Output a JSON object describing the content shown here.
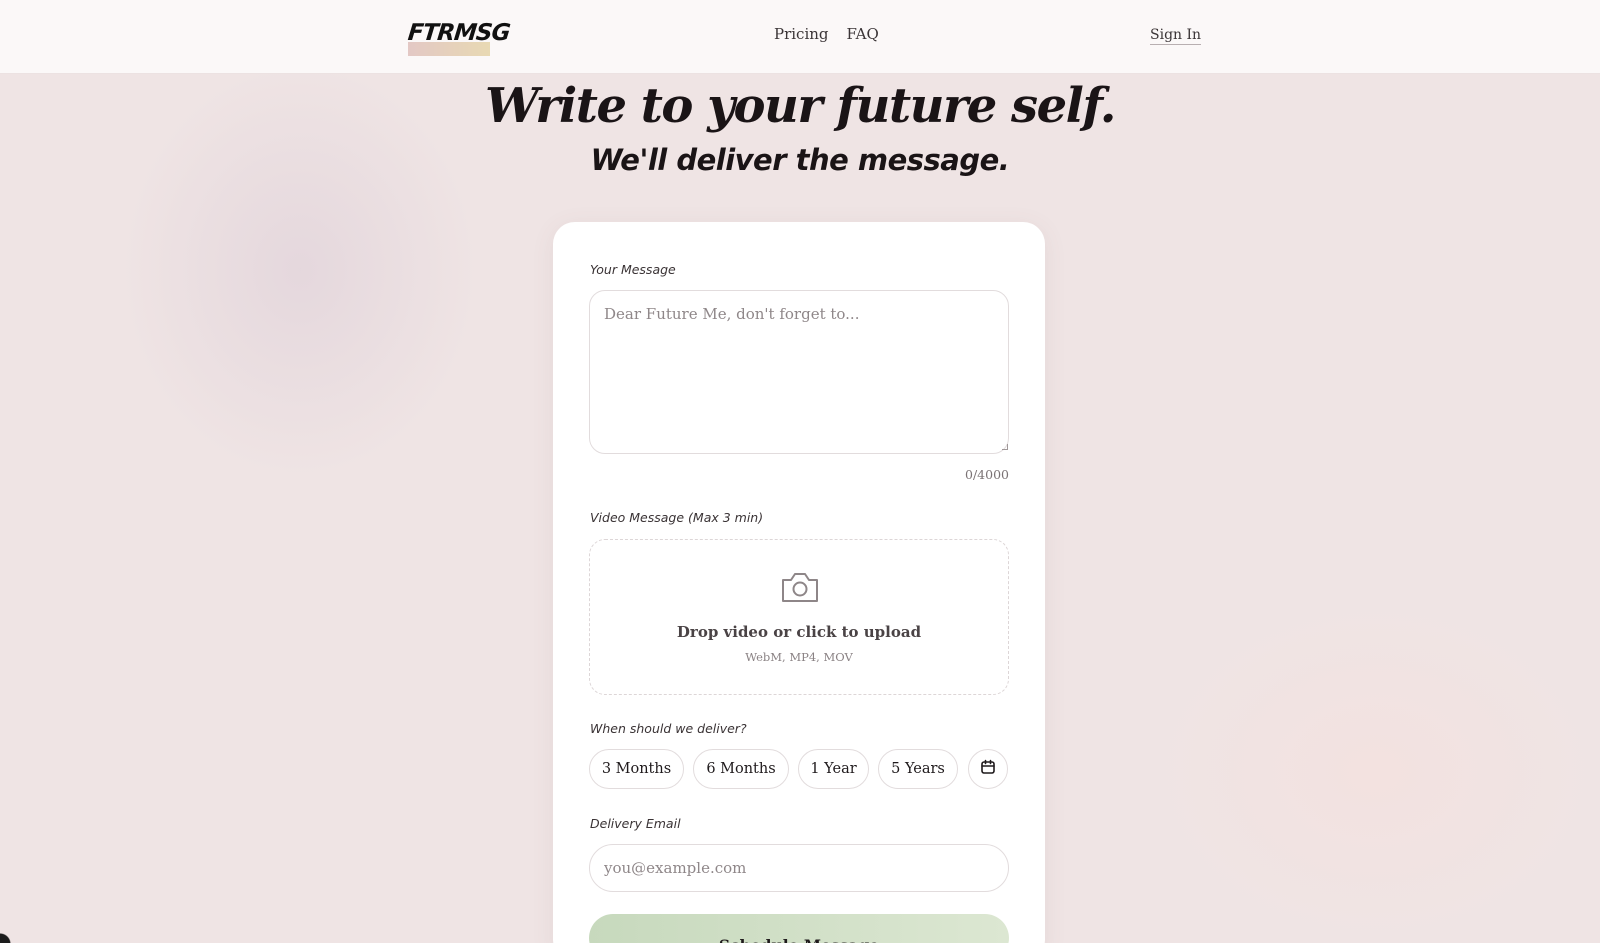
{
  "header": {
    "logo_text": "FTRMSG",
    "nav": [
      {
        "label": "Pricing"
      },
      {
        "label": "FAQ"
      }
    ],
    "sign_in_label": "Sign In"
  },
  "hero": {
    "title": "Write to your future self.",
    "subtitle": "We'll deliver the message."
  },
  "form": {
    "message": {
      "label": "Your Message",
      "placeholder": "Dear Future Me, don't forget to...",
      "value": "",
      "counter": "0/4000"
    },
    "video": {
      "label": "Video Message (Max 3 min)",
      "title": "Drop video or click to upload",
      "hint": "WebM, MP4, MOV",
      "icon": "camera-icon"
    },
    "delivery": {
      "label": "When should we deliver?",
      "options": [
        "3 Months",
        "6 Months",
        "1 Year",
        "5 Years"
      ],
      "custom_date_icon": "calendar-icon"
    },
    "email": {
      "label": "Delivery Email",
      "placeholder": "you@example.com",
      "value": ""
    },
    "submit_label": "Schedule Message"
  },
  "colors": {
    "background": "#efe4e4",
    "card": "#ffffff",
    "submit_gradient_start": "#c7d9bd",
    "submit_gradient_end": "#dce7d2",
    "logo_highlight_start": "#e3c8c5",
    "logo_highlight_end": "#e8d9b3"
  }
}
